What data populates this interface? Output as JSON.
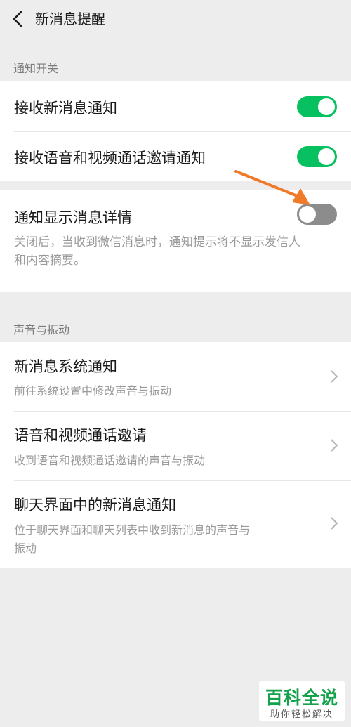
{
  "header": {
    "title": "新消息提醒"
  },
  "section1": {
    "label": "通知开关",
    "items": [
      {
        "label": "接收新消息通知",
        "toggle": "on"
      },
      {
        "label": "接收语音和视频通话邀请通知",
        "toggle": "on"
      }
    ]
  },
  "detail": {
    "label": "通知显示消息详情",
    "toggle": "off",
    "desc_line1": "关闭后，当收到微信消息时，通知提示将不显示发信人",
    "desc_line2": "和内容摘要。"
  },
  "section2": {
    "label": "声音与振动",
    "items": [
      {
        "label": "新消息系统通知",
        "desc_line1": "前往系统设置中修改声音与振动"
      },
      {
        "label": "语音和视频通话邀请",
        "desc_line1": "收到语音和视频通话邀请的声音与振动"
      },
      {
        "label": "聊天界面中的新消息通知",
        "desc_line1": "位于聊天界面和聊天列表中收到新消息的声音与",
        "desc_line2": "振动"
      }
    ]
  },
  "colors": {
    "toggle_on": "#07c160",
    "toggle_off": "#8c8c8c",
    "arrow": "#f07a2a"
  },
  "watermark": {
    "main": "百科全说",
    "sub": "助你轻松解决"
  }
}
